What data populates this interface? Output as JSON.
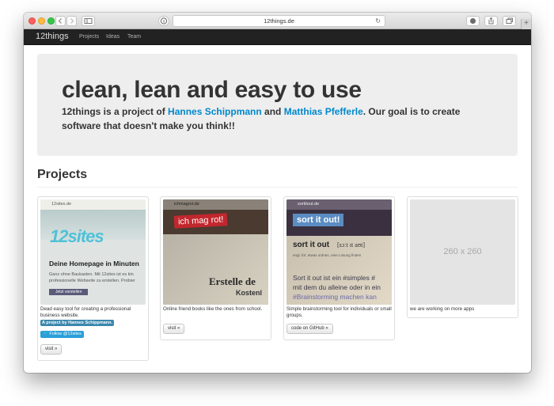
{
  "browser": {
    "url": "12things.de",
    "reload_glyph": "↻",
    "plus_glyph": "+"
  },
  "nav": {
    "brand": "12things",
    "items": [
      {
        "label": "Projects"
      },
      {
        "label": "Ideas"
      },
      {
        "label": "Team"
      }
    ]
  },
  "hero": {
    "title": "clean, lean and easy to use",
    "tagline_prefix": "12things is a project of ",
    "author1": "Hannes Schippmann",
    "tagline_and": " and ",
    "author2": "Matthias Pfefferle",
    "tagline_suffix": ". Our goal is to create software that doesn't make you think!!"
  },
  "projects_heading": "Projects",
  "projects": [
    {
      "caption": "Dead easy tool for creating a professional business website.",
      "label": "A project by Hannes Schippmann.",
      "follow": "Follow @12sites",
      "button": "visit »",
      "image": {
        "url": "12sites.de",
        "logo": "12sites",
        "heading": "Deine Homepage in Minuten",
        "line1": "Ganz ohne Baukasten. Mit 12sites ist es kin",
        "line2": "professionelle Webseite zu erstellen. Probier",
        "cta": "Jetzt vorstellen"
      }
    },
    {
      "caption": "Online friend books like the ones from school.",
      "button": "visit »",
      "image": {
        "url": "ichmagrot.de",
        "sign": "ich mag rot!",
        "line1": "Erstelle de",
        "line2": "Kostenl"
      }
    },
    {
      "caption": "Simple brainstorming tool for individuals or small groups.",
      "button": "code on GitHub »",
      "image": {
        "url": "sortitout.de",
        "sign": "sort it out!",
        "heading": "sort it out",
        "phonetic": "[sɔːt ɪt aʊt]",
        "small": "engl. für: etwas ordnen, eine Lösung finden",
        "line1": "Sort it out ist ein #simples #",
        "line2": "mit dem du alleine oder in ein",
        "line3": "#Brainstorming machen kan"
      }
    },
    {
      "placeholder": "260 x 260",
      "caption": "we are working on more apps"
    }
  ]
}
